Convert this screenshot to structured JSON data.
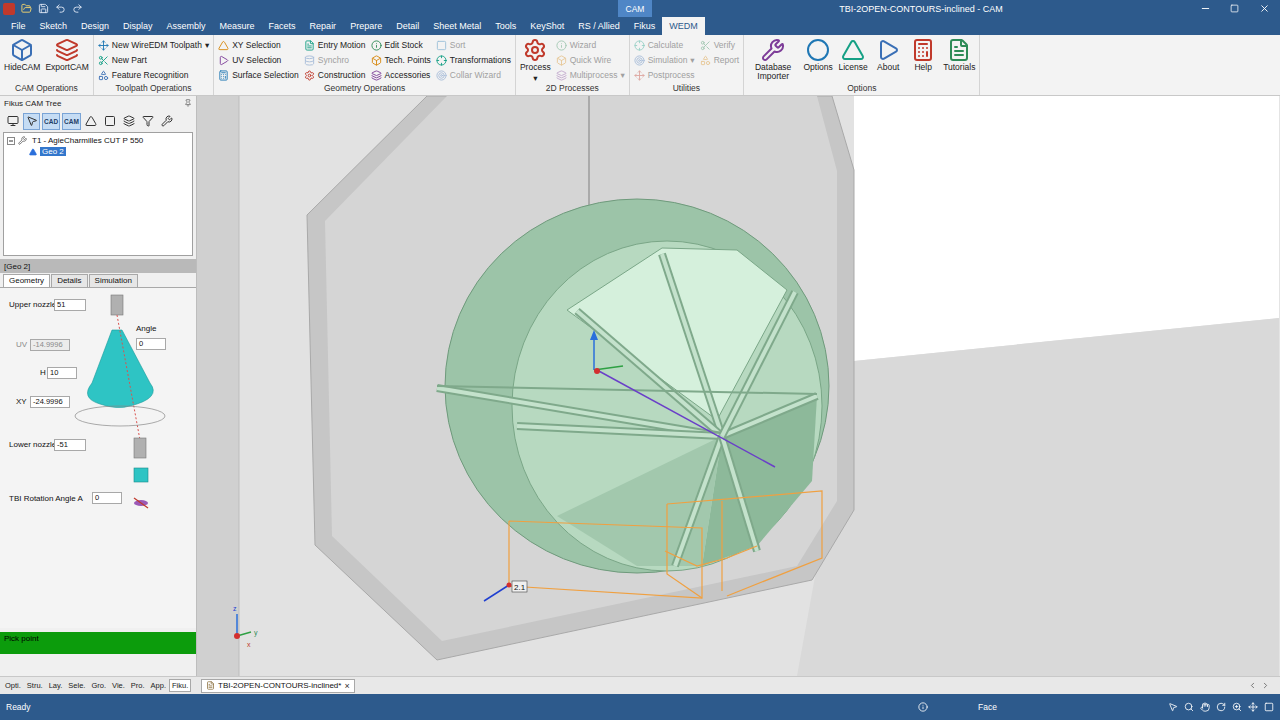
{
  "window": {
    "title": "TBI-2OPEN-CONTOURS-inclined - CAM",
    "context_label": "CAM"
  },
  "menu": [
    {
      "label": "File",
      "selected": false
    },
    {
      "label": "Sketch",
      "selected": false
    },
    {
      "label": "Design",
      "selected": false
    },
    {
      "label": "Display",
      "selected": false
    },
    {
      "label": "Assembly",
      "selected": false
    },
    {
      "label": "Measure",
      "selected": false
    },
    {
      "label": "Facets",
      "selected": false
    },
    {
      "label": "Repair",
      "selected": false
    },
    {
      "label": "Prepare",
      "selected": false
    },
    {
      "label": "Detail",
      "selected": false
    },
    {
      "label": "Sheet Metal",
      "selected": false
    },
    {
      "label": "Tools",
      "selected": false
    },
    {
      "label": "KeyShot",
      "selected": false
    },
    {
      "label": "RS / Allied",
      "selected": false
    },
    {
      "label": "Fikus",
      "selected": false
    },
    {
      "label": "WEDM",
      "selected": true
    }
  ],
  "ribbon": {
    "groups": [
      {
        "title": "CAM Operations",
        "items": [
          {
            "label": "HideCAM",
            "kind": "large",
            "disabled": false
          },
          {
            "label": "ExportCAM",
            "kind": "large",
            "disabled": false
          }
        ]
      },
      {
        "title": "Toolpath Operations",
        "items": [
          {
            "label": "New WireEDM Toolpath",
            "kind": "small",
            "disabled": false,
            "arrow": "▾"
          },
          {
            "label": "New Part",
            "kind": "small",
            "disabled": false
          },
          {
            "label": "Feature Recognition",
            "kind": "small",
            "disabled": false
          }
        ]
      },
      {
        "title": "Geometry Operations",
        "items": [
          {
            "label": "XY Selection",
            "kind": "small",
            "disabled": false
          },
          {
            "label": "UV Selection",
            "kind": "small",
            "disabled": false
          },
          {
            "label": "Surface Selection",
            "kind": "small",
            "disabled": false
          },
          {
            "label": "Entry Motion",
            "kind": "small",
            "disabled": false
          },
          {
            "label": "Synchro",
            "kind": "small",
            "disabled": true
          },
          {
            "label": "Construction",
            "kind": "small",
            "disabled": false
          },
          {
            "label": "Edit Stock",
            "kind": "small",
            "disabled": false
          },
          {
            "label": "Tech. Points",
            "kind": "small",
            "disabled": false
          },
          {
            "label": "Accessories",
            "kind": "small",
            "disabled": false
          },
          {
            "label": "Sort",
            "kind": "small",
            "disabled": true
          },
          {
            "label": "Transformations",
            "kind": "small",
            "disabled": false
          },
          {
            "label": "Collar Wizard",
            "kind": "small",
            "disabled": true
          }
        ]
      },
      {
        "title": "2D Processes",
        "items": [
          {
            "label": "Process",
            "kind": "large",
            "disabled": false,
            "arrow": "▾"
          },
          {
            "label": "Wizard",
            "kind": "small",
            "disabled": true
          },
          {
            "label": "Quick Wire",
            "kind": "small",
            "disabled": true
          },
          {
            "label": "Multiprocess",
            "kind": "small",
            "disabled": true,
            "arrow": "▾"
          }
        ]
      },
      {
        "title": "Utilities",
        "items": [
          {
            "label": "Calculate",
            "kind": "small",
            "disabled": true
          },
          {
            "label": "Simulation",
            "kind": "small",
            "disabled": true,
            "arrow": "▾"
          },
          {
            "label": "Postprocess",
            "kind": "small",
            "disabled": true
          },
          {
            "label": "Verify",
            "kind": "small",
            "disabled": true
          },
          {
            "label": "Report",
            "kind": "small",
            "disabled": true
          }
        ]
      },
      {
        "title": "Options",
        "items": [
          {
            "label": "Database Importer",
            "kind": "large",
            "disabled": false
          },
          {
            "label": "Options",
            "kind": "large",
            "disabled": false
          },
          {
            "label": "License",
            "kind": "large",
            "disabled": false
          },
          {
            "label": "About",
            "kind": "large",
            "disabled": false
          },
          {
            "label": "Help",
            "kind": "large",
            "disabled": false
          },
          {
            "label": "Tutorials",
            "kind": "large",
            "disabled": false
          }
        ]
      }
    ]
  },
  "cam_tree": {
    "title": "Fikus CAM Tree",
    "toolbar": [
      {
        "kind": "icon",
        "selected": false
      },
      {
        "kind": "icon",
        "selected": true
      },
      {
        "kind": "text",
        "text": "CAD",
        "selected": true
      },
      {
        "kind": "text",
        "text": "CAM",
        "selected": true
      },
      {
        "kind": "icon",
        "selected": false
      },
      {
        "kind": "icon",
        "selected": false
      },
      {
        "kind": "icon",
        "selected": false
      },
      {
        "kind": "icon",
        "selected": false
      },
      {
        "kind": "icon",
        "selected": false
      }
    ],
    "items": [
      {
        "label": "T1 - AgieCharmilles CUT P 550",
        "expanded": true,
        "selected": false,
        "children": [
          {
            "label": "Geo 2",
            "selected": true
          }
        ]
      }
    ]
  },
  "properties": {
    "title": "[Geo 2]",
    "tabs": [
      {
        "label": "Geometry",
        "selected": true
      },
      {
        "label": "Details",
        "selected": false
      },
      {
        "label": "Simulation",
        "selected": false
      }
    ],
    "fields": [
      {
        "label": "Upper nozzle",
        "value": "51",
        "disabled": false
      },
      {
        "label": "Angle",
        "value": "0",
        "disabled": false
      },
      {
        "label": "UV",
        "value": "-14.9996",
        "disabled": true
      },
      {
        "label": "H",
        "value": "10",
        "disabled": false
      },
      {
        "label": "XY",
        "value": "-24.9996",
        "disabled": false
      },
      {
        "label": "Lower nozzle",
        "value": "-51",
        "disabled": false
      },
      {
        "label": "TBI Rotation Angle A",
        "value": "0",
        "disabled": false
      }
    ]
  },
  "prompt": "Pick point",
  "panel_tabs": [
    {
      "label": "Opti.",
      "selected": false
    },
    {
      "label": "Stru.",
      "selected": false
    },
    {
      "label": "Lay.",
      "selected": false
    },
    {
      "label": "Sele.",
      "selected": false
    },
    {
      "label": "Gro.",
      "selected": false
    },
    {
      "label": "Vie.",
      "selected": false
    },
    {
      "label": "Pro.",
      "selected": false
    },
    {
      "label": "App.",
      "selected": false
    },
    {
      "label": "Fiku.",
      "selected": true
    }
  ],
  "documents": [
    {
      "label": "TBI-2OPEN-CONTOURS-inclined*",
      "selected": true,
      "close": "×"
    }
  ],
  "viewport": {
    "tag": "2.1",
    "axes": [
      "z",
      "y",
      "x"
    ]
  },
  "status_bar": {
    "text": "Ready",
    "selection": "Face"
  }
}
